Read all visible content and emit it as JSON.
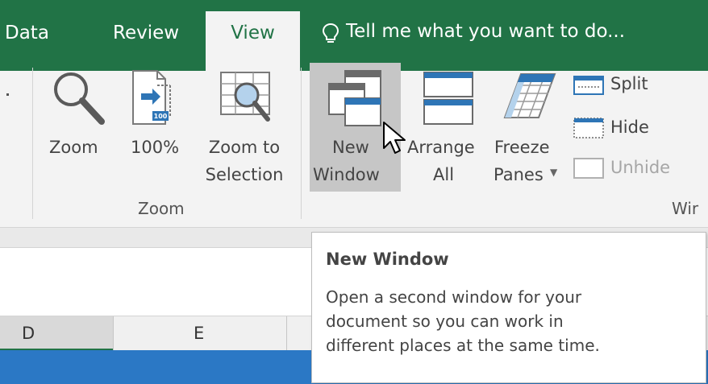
{
  "tabs": {
    "data": "Data",
    "review": "Review",
    "view": "View"
  },
  "tell_me": {
    "icon": "lightbulb-icon",
    "text": "Tell me what you want to do..."
  },
  "ribbon": {
    "zoom_group": {
      "label": "Zoom",
      "buttons": {
        "zoom": "Zoom",
        "hundred": "100%",
        "hundred_badge": "100",
        "zoom_to_line1": "Zoom to",
        "zoom_to_line2": "Selection"
      }
    },
    "window_group": {
      "label": "Wir",
      "buttons": {
        "new_line1": "New",
        "new_line2": "Window",
        "arrange_line1": "Arrange",
        "arrange_line2": "All",
        "freeze_line1": "Freeze",
        "freeze_line2": "Panes",
        "split": "Split",
        "hide": "Hide",
        "unhide": "Unhide"
      }
    }
  },
  "sheet": {
    "columns": [
      "D",
      "E"
    ]
  },
  "tooltip": {
    "title": "New Window",
    "lines": [
      "Open a second window for your",
      "document so you can work in",
      "different places at the same time."
    ]
  },
  "colors": {
    "ribbon_green": "#217346",
    "ribbon_bg": "#f3f3f3",
    "accent_blue": "#2b78c5",
    "icon_blue": "#2e75b6"
  }
}
